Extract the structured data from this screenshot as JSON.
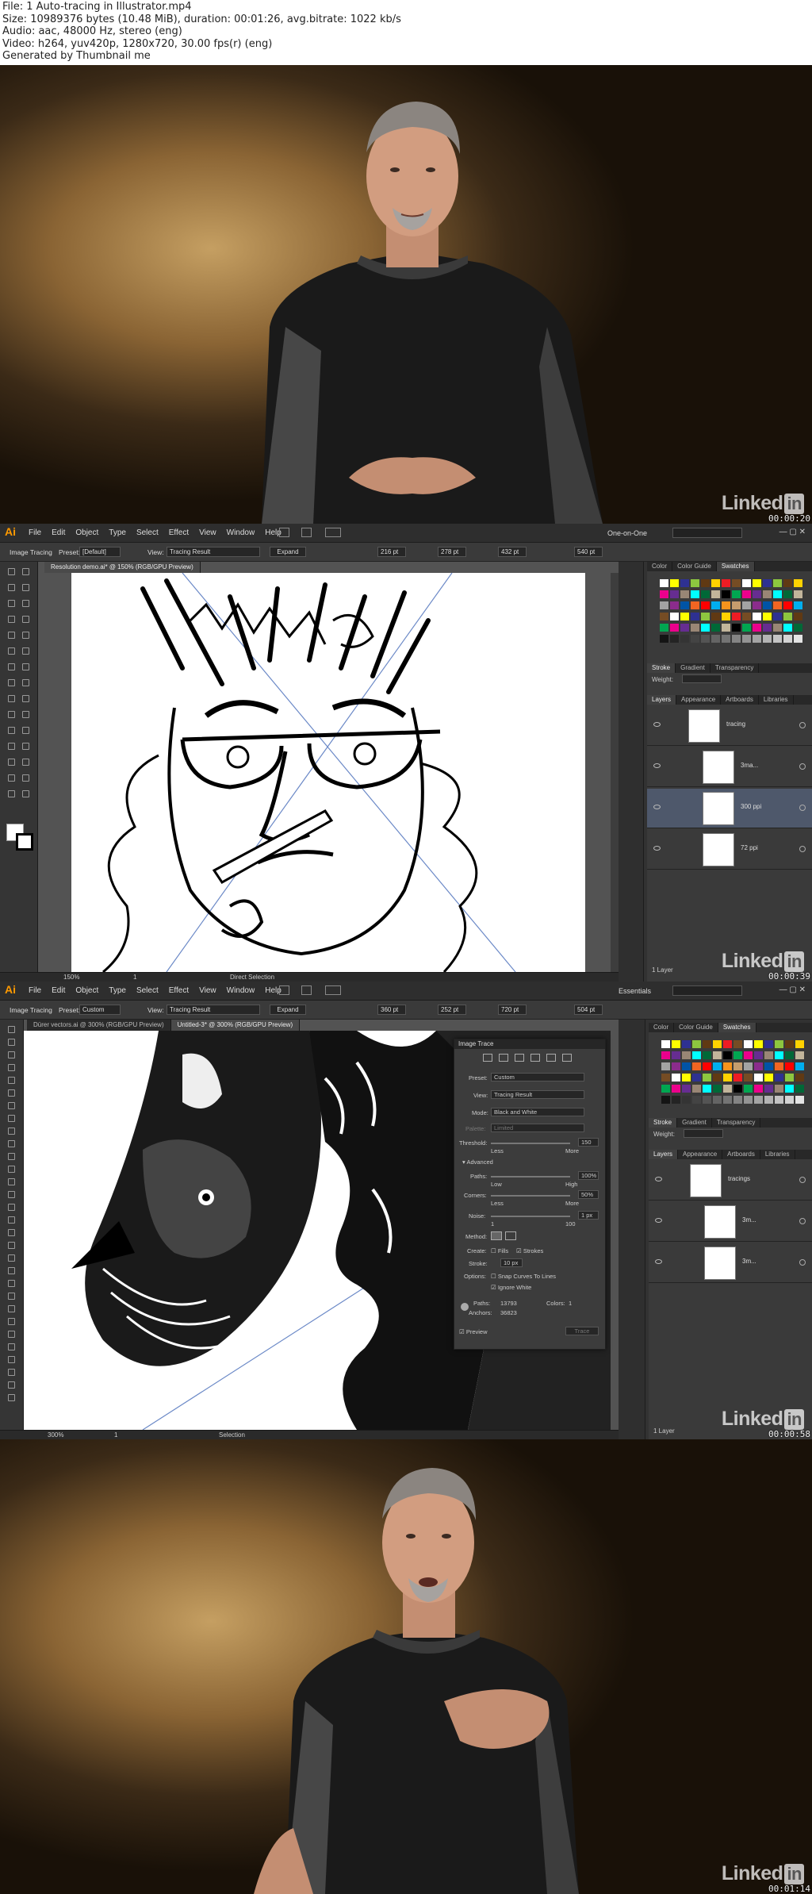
{
  "header": {
    "file": "File: 1 Auto-tracing in Illustrator.mp4",
    "size": "Size: 10989376 bytes (10.48 MiB), duration: 00:01:26, avg.bitrate: 1022 kb/s",
    "audio": "Audio: aac, 48000 Hz, stereo (eng)",
    "video": "Video: h264, yuv420p, 1280x720, 30.00 fps(r) (eng)",
    "generated": "Generated by Thumbnail me"
  },
  "frames": [
    {
      "timestamp": "00:00:20",
      "brand": "Linked",
      "brand_in": "in"
    },
    {
      "timestamp": "00:00:39",
      "brand": "Linked",
      "brand_in": "in"
    },
    {
      "timestamp": "00:00:58",
      "brand": "Linked",
      "brand_in": "in"
    },
    {
      "timestamp": "00:01:14",
      "brand": "Linked",
      "brand_in": "in"
    }
  ],
  "illustrator": {
    "app_logo": "Ai",
    "menu": [
      "File",
      "Edit",
      "Object",
      "Type",
      "Select",
      "Effect",
      "View",
      "Window",
      "Help"
    ],
    "workspace_1": "One-on-One",
    "workspace_2": "Essentials",
    "control_label": "Image Tracing",
    "preset_label": "Preset:",
    "preset_value_1": "[Default]",
    "preset_value_2": "Custom",
    "view_label": "View:",
    "view_value": "Tracing Result",
    "expand": "Expand",
    "frame2": {
      "x": "216 pt",
      "y": "278 pt",
      "w": "432 pt",
      "h": "540 pt",
      "tab": "Resolution demo.ai* @ 150% (RGB/GPU Preview)",
      "zoom": "150%",
      "page": "1",
      "status": "Direct Selection",
      "layers_count": "1 Layer",
      "layers": [
        {
          "name": "tracing",
          "indent": 0
        },
        {
          "name": "3ma...",
          "indent": 1
        },
        {
          "name": "300 ppi",
          "indent": 1
        },
        {
          "name": "72 ppi",
          "indent": 1
        }
      ]
    },
    "frame3": {
      "x": "360 pt",
      "y": "252 pt",
      "w": "720 pt",
      "h": "504 pt",
      "tabs": [
        "Dürer vectors.ai @ 300% (RGB/GPU Preview)",
        "Untitled-3* @ 300% (RGB/GPU Preview)"
      ],
      "zoom": "300%",
      "page": "1",
      "status": "Selection",
      "layers_count": "1 Layer",
      "layers": [
        {
          "name": "tracings",
          "indent": 0
        },
        {
          "name": "3m...",
          "indent": 1
        },
        {
          "name": "3m...",
          "indent": 1
        }
      ]
    },
    "panel_tabs_top": [
      "Color",
      "Color Guide",
      "Swatches"
    ],
    "panel_tabs_mid": [
      "Stroke",
      "Gradient",
      "Transparency"
    ],
    "weight_label": "Weight:",
    "panel_tabs_bot": [
      "Layers",
      "Appearance",
      "Artboards",
      "Libraries"
    ],
    "image_trace": {
      "title": "Image Trace",
      "preset_label": "Preset:",
      "preset": "Custom",
      "view_label": "View:",
      "view": "Tracing Result",
      "mode_label": "Mode:",
      "mode": "Black and White",
      "palette_label": "Palette:",
      "palette": "Limited",
      "threshold_label": "Threshold:",
      "threshold": "150",
      "less": "Less",
      "more": "More",
      "advanced": "Advanced",
      "paths_label": "Paths:",
      "paths": "100%",
      "low": "Low",
      "high": "High",
      "corners_label": "Corners:",
      "corners": "50%",
      "noise_label": "Noise:",
      "noise": "1 px",
      "noise_min": "1",
      "noise_max": "100",
      "method_label": "Method:",
      "create_label": "Create:",
      "fills": "Fills",
      "strokes": "Strokes",
      "stroke_label": "Stroke:",
      "stroke": "10 px",
      "options_label": "Options:",
      "snap": "Snap Curves To Lines",
      "ignore": "Ignore White",
      "paths_count_label": "Paths:",
      "paths_count": "13793",
      "anchors_label": "Anchors:",
      "anchors": "36823",
      "colors_label": "Colors:",
      "colors": "1",
      "preview": "Preview",
      "trace": "Trace"
    }
  }
}
